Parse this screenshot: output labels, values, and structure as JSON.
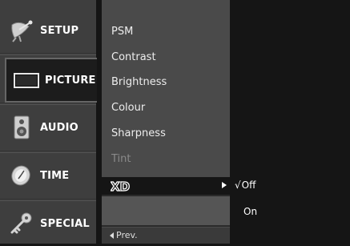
{
  "sidebar": {
    "tabs": [
      {
        "label": "SETUP",
        "icon": "satellite-dish-icon"
      },
      {
        "label": "PICTURE",
        "icon": "tv-screen-icon",
        "selected": true
      },
      {
        "label": "AUDIO",
        "icon": "speaker-icon"
      },
      {
        "label": "TIME",
        "icon": "clock-icon"
      },
      {
        "label": "SPECIAL",
        "icon": "key-icon"
      }
    ]
  },
  "menu": {
    "items": [
      {
        "label": "PSM"
      },
      {
        "label": "Contrast"
      },
      {
        "label": "Brightness"
      },
      {
        "label": "Colour"
      },
      {
        "label": "Sharpness"
      },
      {
        "label": "Tint",
        "disabled": true
      }
    ],
    "xd_logo": "XD",
    "prev_label": "Prev."
  },
  "submenu": {
    "check_mark": "√",
    "options": [
      {
        "label": "Off",
        "selected": true
      },
      {
        "label": "On"
      }
    ]
  }
}
